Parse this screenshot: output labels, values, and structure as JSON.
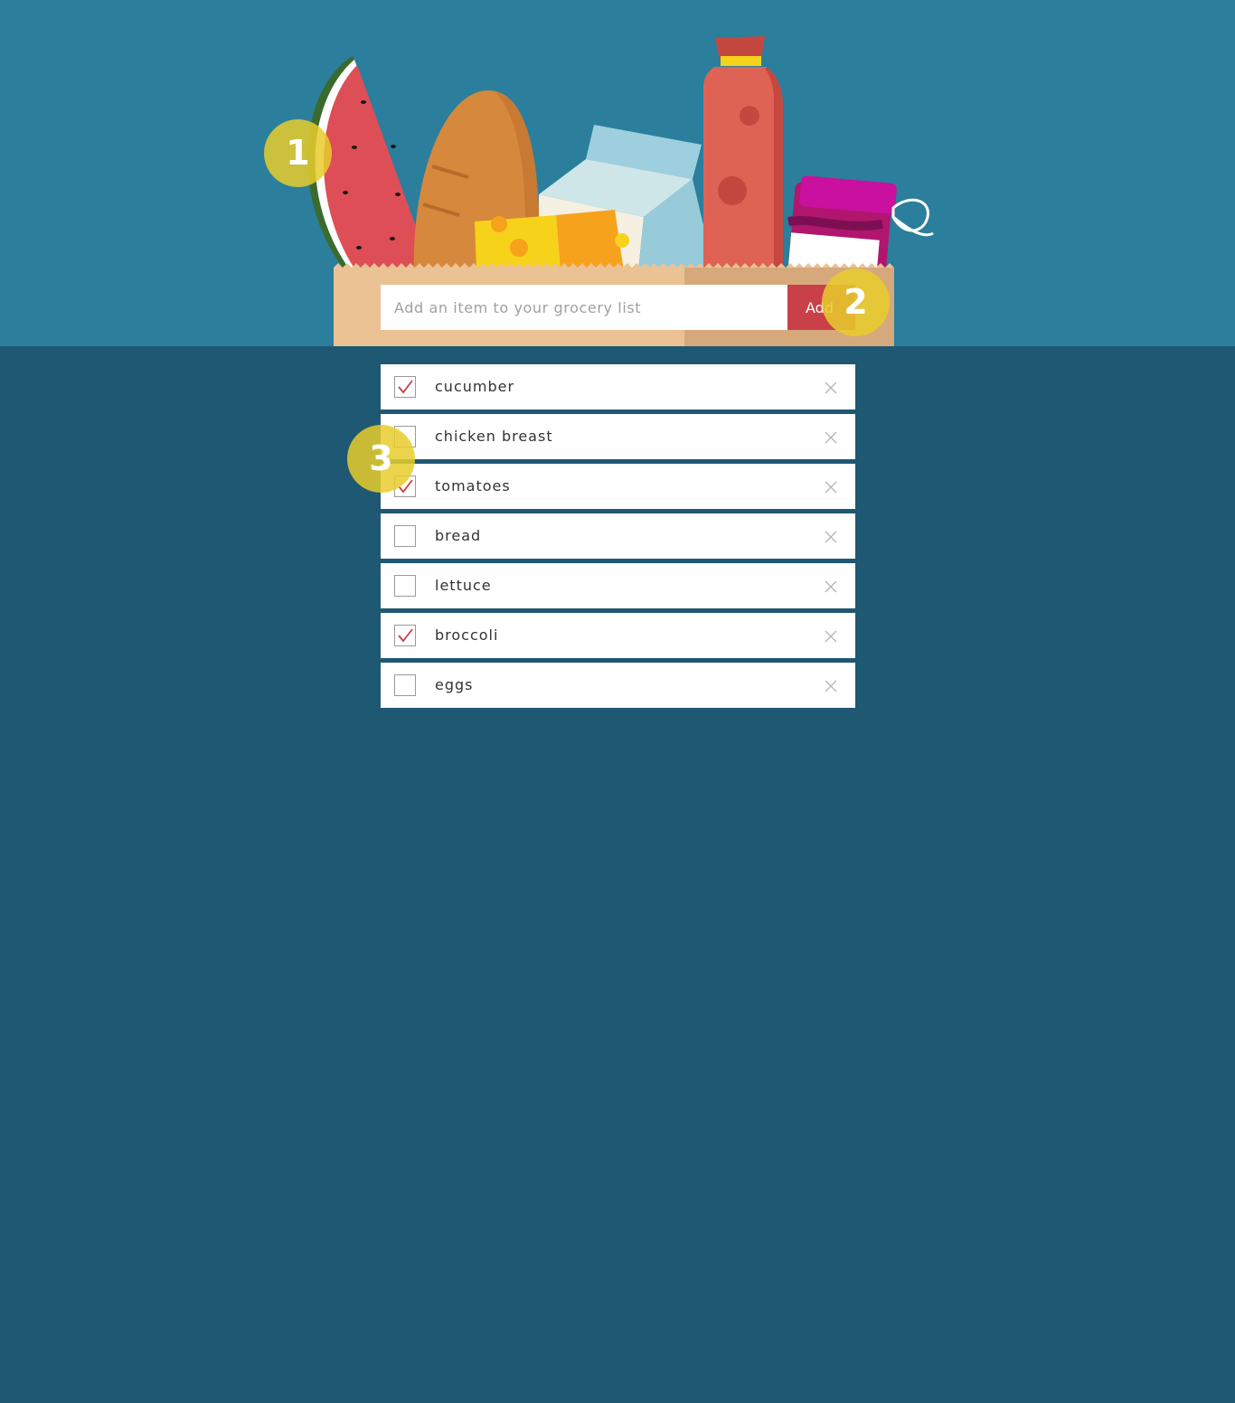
{
  "add_form": {
    "placeholder": "Add an item to your grocery list",
    "button_label": "Add"
  },
  "items": [
    {
      "label": "cucumber",
      "checked": true
    },
    {
      "label": "chicken breast",
      "checked": false
    },
    {
      "label": "tomatoes",
      "checked": true
    },
    {
      "label": "bread",
      "checked": false
    },
    {
      "label": "lettuce",
      "checked": false
    },
    {
      "label": "broccoli",
      "checked": true
    },
    {
      "label": "eggs",
      "checked": false
    }
  ],
  "markers": [
    "1",
    "2",
    "3"
  ],
  "colors": {
    "header_bg": "#2b7e9c",
    "page_bg": "#1f5872",
    "accent": "#c94048",
    "marker": "#e8cd2b"
  },
  "icons": {
    "checkmark": "checkmark-icon",
    "remove": "close-icon"
  }
}
